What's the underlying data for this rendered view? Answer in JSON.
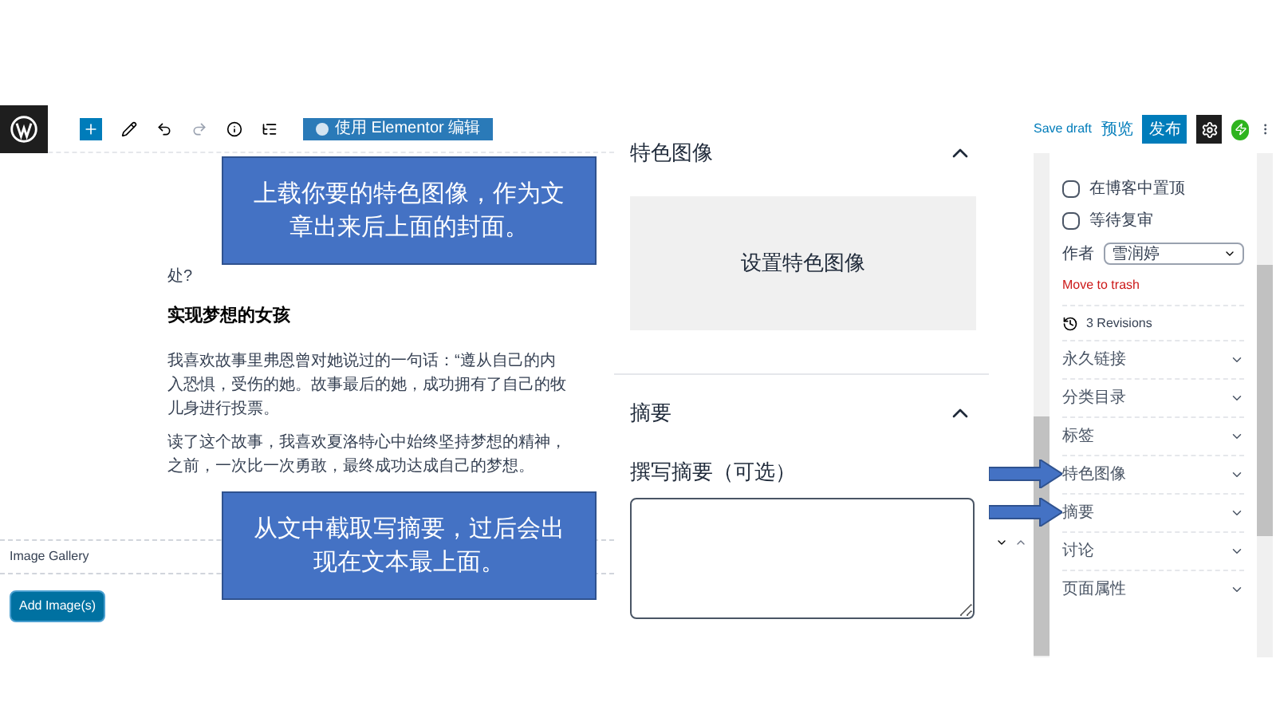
{
  "toolbar": {
    "elementor_button": "使用 Elementor 编辑",
    "save_draft": "Save draft",
    "preview": "预览",
    "publish": "发布"
  },
  "editor": {
    "fragment": "处?",
    "heading": "实现梦想的女孩",
    "paragraphs": [
      [
        "我喜欢故事里弗恩曾对她说过的一句话：“遵从自己的内",
        "入恐惧，受伤的她。故事最后的她，成功拥有了自己的牧",
        "儿身进行投票。"
      ],
      [
        "读了这个故事，我喜欢夏洛特心中始终坚持梦想的精神，",
        "之前，一次比一次勇敢，最终成功达成自己的梦想。"
      ]
    ],
    "gallery_label": "Image Gallery",
    "add_images": "Add Image(s)"
  },
  "featured_panel": {
    "title": "特色图像",
    "expanded": true,
    "set_image": "设置特色图像"
  },
  "excerpt_panel": {
    "title": "摘要",
    "expanded": true,
    "label": "撰写摘要（可选）"
  },
  "sidebar": {
    "checkboxes": [
      {
        "label": "在博客中置顶",
        "checked": false
      },
      {
        "label": "等待复审",
        "checked": false
      }
    ],
    "author": {
      "label": "作者",
      "value": "雪润婷"
    },
    "trash": "Move to trash",
    "revisions": "3 Revisions",
    "panels": [
      {
        "label": "永久链接",
        "expanded": false,
        "pointed": false
      },
      {
        "label": "分类目录",
        "expanded": false,
        "pointed": false
      },
      {
        "label": "标签",
        "expanded": false,
        "pointed": false
      },
      {
        "label": "特色图像",
        "expanded": false,
        "pointed": true
      },
      {
        "label": "摘要",
        "expanded": false,
        "pointed": true
      },
      {
        "label": "讨论",
        "expanded": false,
        "pointed": false
      },
      {
        "label": "页面属性",
        "expanded": false,
        "pointed": false
      }
    ]
  },
  "callouts": [
    {
      "text": "上载你要的特色图像，作为文章出来后上面的封面。"
    },
    {
      "text": "从文中截取写摘要，过后会出现在文本最上面。"
    }
  ]
}
